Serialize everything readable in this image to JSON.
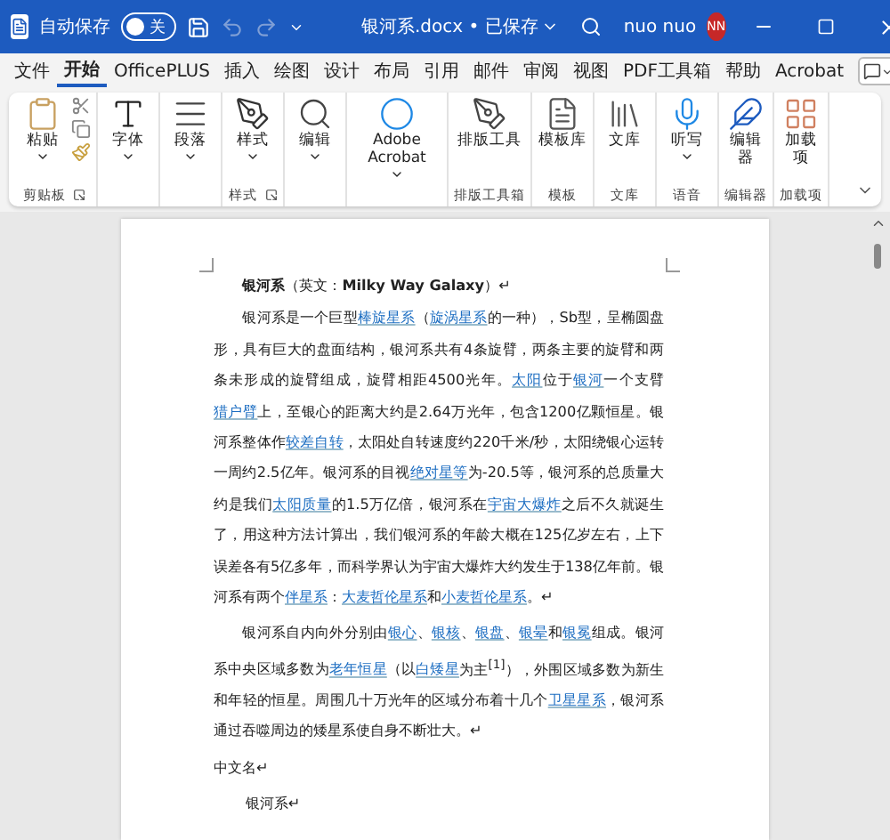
{
  "title_bar": {
    "autosave_label": "自动保存",
    "autosave": {
      "on": false,
      "label": "关"
    },
    "redo_disabled": true,
    "document_title": "银河系.docx • 已保存",
    "user_name": "nuo nuo",
    "avatar_initials": "NN"
  },
  "menu_tabs": [
    {
      "label": "文件",
      "selected": false
    },
    {
      "label": "开始",
      "selected": true
    },
    {
      "label": "OfficePLUS",
      "selected": false
    },
    {
      "label": "插入",
      "selected": false
    },
    {
      "label": "绘图",
      "selected": false
    },
    {
      "label": "设计",
      "selected": false
    },
    {
      "label": "布局",
      "selected": false
    },
    {
      "label": "引用",
      "selected": false
    },
    {
      "label": "邮件",
      "selected": false
    },
    {
      "label": "审阅",
      "selected": false
    },
    {
      "label": "视图",
      "selected": false
    },
    {
      "label": "PDF工具箱",
      "selected": false
    },
    {
      "label": "帮助",
      "selected": false
    },
    {
      "label": "Acrobat",
      "selected": false
    }
  ],
  "ribbon": {
    "groups": [
      {
        "button": "粘贴",
        "dropdown": true,
        "label": "剪贴板",
        "launcher": true
      },
      {
        "button": "字体",
        "dropdown": true
      },
      {
        "button": "段落",
        "dropdown": true
      },
      {
        "button": "样式",
        "dropdown": true,
        "label": "样式",
        "launcher": true
      },
      {
        "button": "编辑",
        "dropdown": true
      },
      {
        "button": "Adobe Acrobat",
        "dropdown": true
      },
      {
        "button": "排版工具",
        "dropdown": false,
        "label": "排版工具箱"
      },
      {
        "button": "模板库",
        "dropdown": false,
        "label": "模板"
      },
      {
        "button": "文库",
        "dropdown": false,
        "label": "文库"
      },
      {
        "button": "听写",
        "dropdown": true,
        "label": "语音"
      },
      {
        "button": "编辑器",
        "dropdown": false,
        "label": "编辑器"
      },
      {
        "button": "加载项",
        "dropdown": false,
        "label": "加载项"
      }
    ]
  },
  "document": {
    "paragraphs": [
      {
        "kind": "heading",
        "segments": [
          {
            "text": "**银河系**（英文：**Milky Way Galaxy**）↵",
            "link": false
          }
        ]
      },
      {
        "kind": "body",
        "segments": [
          {
            "text": "银河系是一个巨型",
            "link": false
          },
          {
            "text": "棒旋星系",
            "link": true
          },
          {
            "text": "（",
            "link": false
          },
          {
            "text": "旋涡星系",
            "link": true
          },
          {
            "text": "的一种），Sb型，呈椭圆盘形，具有巨大的盘面结构，银河系共有4条旋臂，两条主要的旋臂和两条未形成的旋臂组成，旋臂相距4500光年。",
            "link": false
          },
          {
            "text": "太阳",
            "link": true
          },
          {
            "text": "位于",
            "link": false
          },
          {
            "text": "银河",
            "link": true
          },
          {
            "text": "一个支臂",
            "link": false
          },
          {
            "text": "猎户臂",
            "link": true
          },
          {
            "text": "上，至银心的距离大约是2.64万光年，包含1200亿颗恒星。银河系整体作",
            "link": false
          },
          {
            "text": "较差自转",
            "link": true
          },
          {
            "text": "，太阳处自转速度约220千米/秒，太阳绕银心运转一周约2.5亿年。银河系的目视",
            "link": false
          },
          {
            "text": "绝对星等",
            "link": true
          },
          {
            "text": "为-20.5等，银河系的总质量大约是我们",
            "link": false
          },
          {
            "text": "太阳质量",
            "link": true
          },
          {
            "text": "的1.5万亿倍，银河系在",
            "link": false
          },
          {
            "text": "宇宙大爆炸",
            "link": true
          },
          {
            "text": "之后不久就诞生了，用这种方法计算出，我们银河系的年龄大概在125亿岁左右，上下误差各有5亿多年，而科学界认为宇宙大爆炸大约发生于138亿年前。银河系有两个",
            "link": false
          },
          {
            "text": "伴星系",
            "link": true
          },
          {
            "text": "：",
            "link": false
          },
          {
            "text": "大麦哲伦星系",
            "link": true
          },
          {
            "text": "和",
            "link": false
          },
          {
            "text": "小麦哲伦星系",
            "link": true
          },
          {
            "text": "。↵",
            "link": false
          }
        ]
      },
      {
        "kind": "body",
        "segments": [
          {
            "text": "银河系自内向外分别由",
            "link": false
          },
          {
            "text": "银心",
            "link": true
          },
          {
            "text": "、",
            "link": false
          },
          {
            "text": "银核",
            "link": true
          },
          {
            "text": "、",
            "link": false
          },
          {
            "text": "银盘",
            "link": true
          },
          {
            "text": "、",
            "link": false
          },
          {
            "text": "银晕",
            "link": true
          },
          {
            "text": "和",
            "link": false
          },
          {
            "text": "银冕",
            "link": true
          },
          {
            "text": "组成。银河系中央区域多数为",
            "link": false
          },
          {
            "text": "老年恒星",
            "link": true
          },
          {
            "text": "（以",
            "link": false
          },
          {
            "text": "白矮星",
            "link": true
          },
          {
            "text": "为主$^{[1]}$），外围区域多数为新生和年轻的恒星。周围几十万光年的区域分布着十几个",
            "link": false
          },
          {
            "text": "卫星星系",
            "link": true
          },
          {
            "text": "，银河系通过吞噬周边的矮星系使自身不断壮大。↵",
            "link": false
          }
        ]
      },
      {
        "kind": "plain",
        "segments": [
          {
            "text": "中文名↵",
            "link": false
          }
        ]
      },
      {
        "kind": "indented",
        "segments": [
          {
            "text": "银河系↵",
            "link": false
          }
        ]
      }
    ]
  }
}
